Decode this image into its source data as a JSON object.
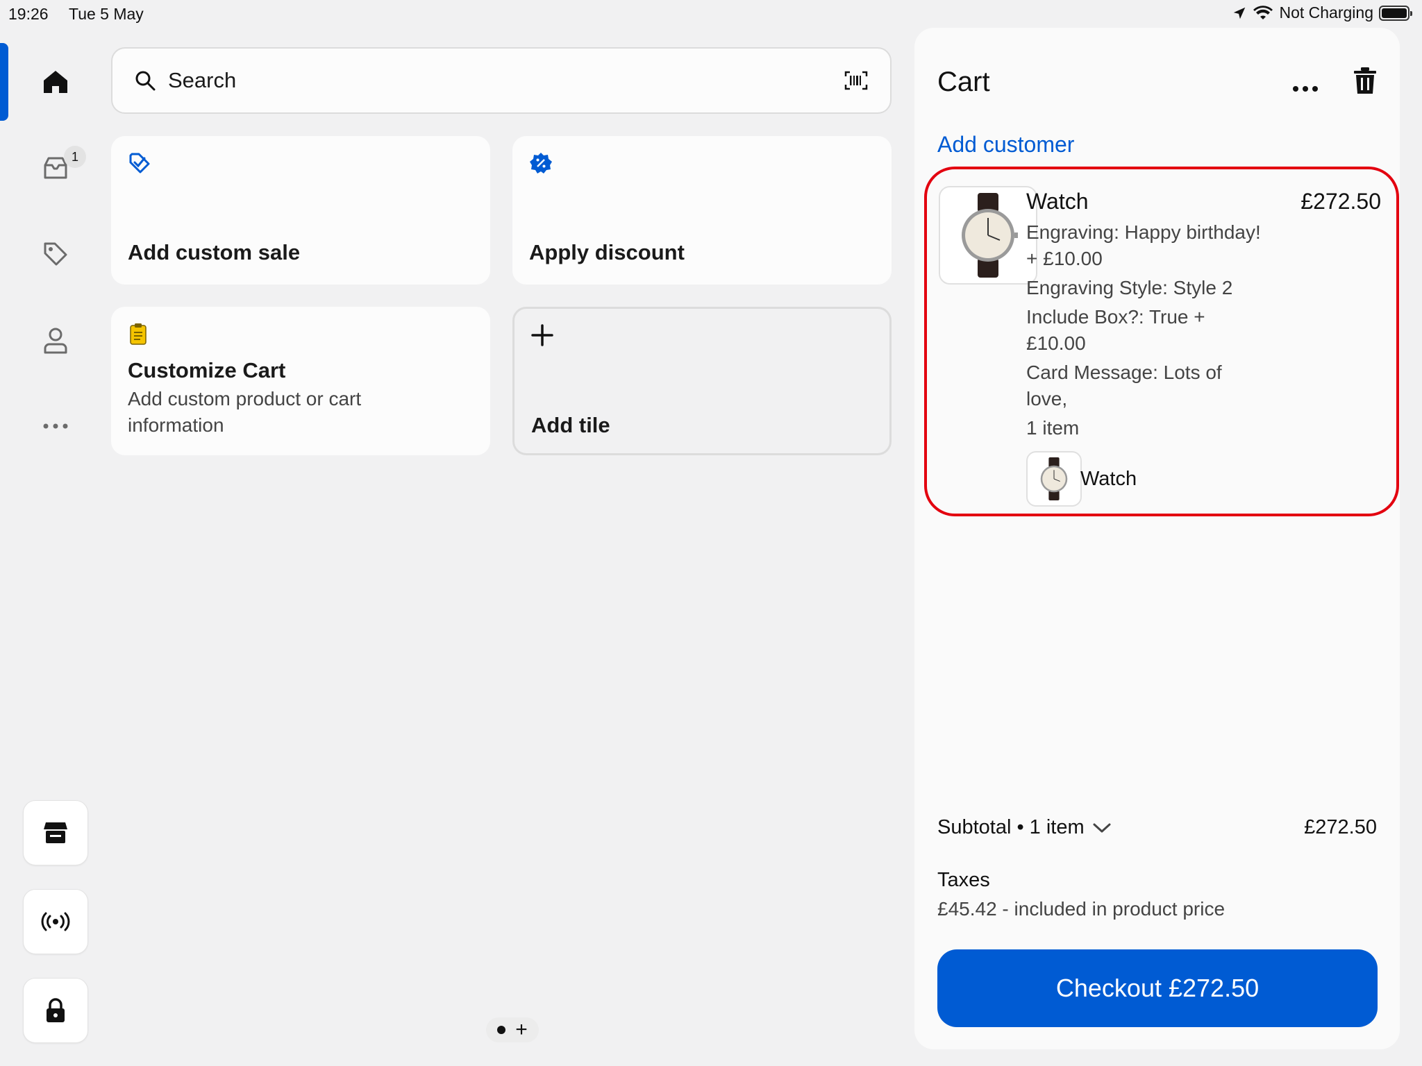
{
  "status_bar": {
    "time": "19:26",
    "date": "Tue 5 May",
    "charging": "Not Charging"
  },
  "sidebar": {
    "items": [
      {
        "icon": "home-icon"
      },
      {
        "icon": "inbox-icon",
        "badge": "1"
      },
      {
        "icon": "tag-icon"
      },
      {
        "icon": "person-icon"
      },
      {
        "icon": "more-horizontal-icon"
      }
    ],
    "bottom_buttons": [
      {
        "icon": "store-icon"
      },
      {
        "icon": "broadcast-icon"
      },
      {
        "icon": "lock-icon"
      }
    ]
  },
  "search": {
    "placeholder": "Search"
  },
  "tiles": {
    "custom_sale": {
      "title": "Add custom sale"
    },
    "discount": {
      "title": "Apply discount"
    },
    "customize_cart": {
      "title": "Customize Cart",
      "subtitle": "Add custom product or cart information"
    },
    "add_tile": {
      "title": "Add tile"
    }
  },
  "cart": {
    "title": "Cart",
    "add_customer": "Add customer",
    "item": {
      "name": "Watch",
      "price": "£272.50",
      "properties": [
        "Engraving: Happy birthday! + £10.00",
        "Engraving Style: Style 2",
        "Include Box?: True + £10.00",
        "Card Message: Lots of love,",
        "1 item"
      ],
      "bundle_item_name": "Watch"
    },
    "subtotal_label": "Subtotal • 1 item",
    "subtotal_value": "£272.50",
    "taxes_label": "Taxes",
    "taxes_note": "£45.42 - included in product price",
    "checkout_label": "Checkout £272.50"
  },
  "colors": {
    "accent": "#005bd3",
    "highlight_border": "#e3000f",
    "customize_icon": "#f5c400"
  }
}
